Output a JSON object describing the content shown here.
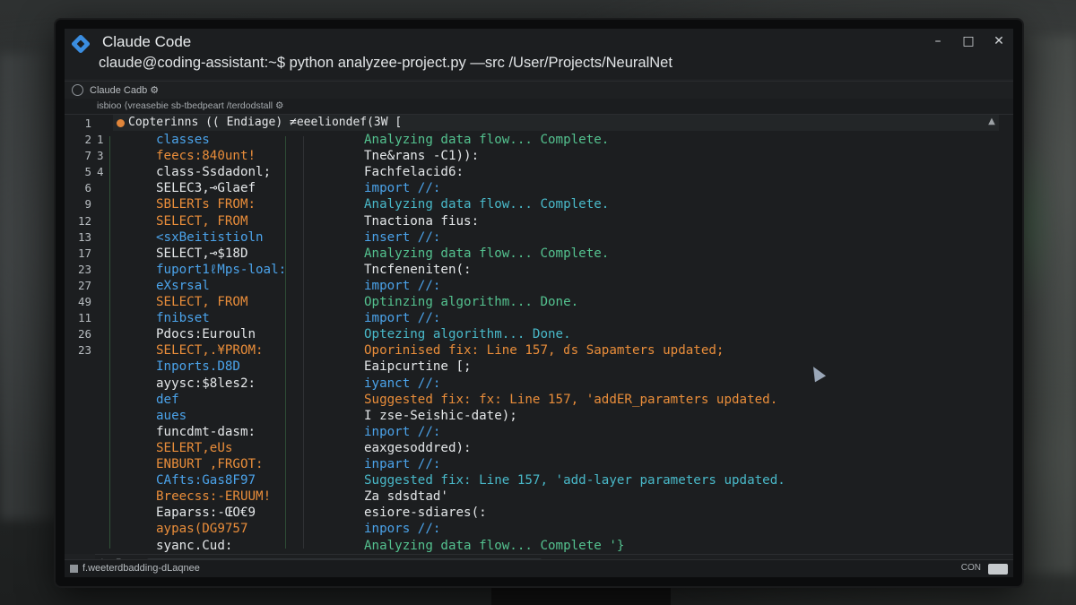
{
  "window": {
    "app_title": "Claude Code",
    "command": "claude@coding-assistant:~$ python analyzee-project.py —src /User/Projects/NeuralNet",
    "controls": [
      "–",
      "□",
      "✕"
    ]
  },
  "tab": {
    "label": "Claude Cadb ⚙"
  },
  "breadcrumb": "isbioo ⟨vreasebie sb-tbedpeart /terdodstall ⚙",
  "editor": {
    "header_text": "Copterinns (( Endiage) ≠eeeliondef(3W [",
    "line_numbers": [
      "2",
      "7",
      "5",
      "6",
      "9",
      "12",
      "13",
      "17",
      "23",
      "27",
      "49",
      "11",
      "26",
      "23"
    ],
    "line_numbers_top": "1",
    "secondary_numbers": [
      "1",
      "3",
      "4"
    ],
    "left_lines": [
      {
        "text": "classes",
        "color": "blue"
      },
      {
        "text": "feecs:840unt!",
        "color": "orange"
      },
      {
        "text": "class-Ssdadonl;",
        "color": "white"
      },
      {
        "text": "SELEC3,⊸Glaef",
        "color": "white"
      },
      {
        "text": "SBLERTs  FROM:",
        "color": "orange"
      },
      {
        "text": "SELECT, FROM",
        "color": "orange"
      },
      {
        "text": "<sxBeitistioln",
        "color": "blue"
      },
      {
        "text": "SELECT,⊸$18D",
        "color": "white"
      },
      {
        "text": "fuport1ℓMps-loal:",
        "color": "blue"
      },
      {
        "text": "eXsrsal",
        "color": "blue"
      },
      {
        "text": "SELECT, FROM",
        "color": "orange"
      },
      {
        "text": "fnibset",
        "color": "blue"
      },
      {
        "text": "Pdocs:Eurouln",
        "color": "white"
      },
      {
        "text": "SELECT,.¥PROM:",
        "color": "orange"
      },
      {
        "text": "Inports.D8D",
        "color": "blue"
      },
      {
        "text": "ayysc:$8les2:",
        "color": "white"
      },
      {
        "text": "def",
        "color": "blue"
      },
      {
        "text": "aues",
        "color": "blue"
      },
      {
        "text": "funcdmt-dasm:",
        "color": "white"
      },
      {
        "text": "SELERT,eUs",
        "color": "orange"
      },
      {
        "text": "ENBURT ,FRGOT:",
        "color": "orange"
      },
      {
        "text": "CAfts:Gas8F97",
        "color": "blue"
      },
      {
        "text": "Breecss:-ERUUM!",
        "color": "orange"
      },
      {
        "text": "Eaparss:-ŒO€9",
        "color": "white"
      },
      {
        "text": "aypas(DG9757",
        "color": "orange"
      },
      {
        "text": "syanc.Cud:",
        "color": "white"
      }
    ],
    "right_lines": [
      {
        "text": "Analyzing data flow... Complete.",
        "color": "green"
      },
      {
        "text": "Tne&rans -C1)):",
        "color": "white"
      },
      {
        "text": "Fachfelacid6:",
        "color": "white"
      },
      {
        "text": "import //:",
        "color": "blue"
      },
      {
        "text": "Analyzing data flow... Complete.",
        "color": "teal"
      },
      {
        "text": "Tnactiona fius:",
        "color": "white"
      },
      {
        "text": "insert //:",
        "color": "blue"
      },
      {
        "text": "Analyzing data flow... Complete.",
        "color": "green"
      },
      {
        "text": "Tncfeneniten(:",
        "color": "white"
      },
      {
        "text": "import //:",
        "color": "blue"
      },
      {
        "text": "Optinzing algorithm... Done.",
        "color": "green"
      },
      {
        "text": "import //:",
        "color": "blue"
      },
      {
        "text": "Optezing algorithm... Done.",
        "color": "teal"
      },
      {
        "text": "Oporinised fix: Line 157, ɗs Sapamters updated;",
        "color": "orange"
      },
      {
        "text": " Eaipcurtine [;",
        "color": "white"
      },
      {
        "text": "iyanct //:",
        "color": "blue"
      },
      {
        "text": "Suggested fix: fx: Line 157, 'addER_paramters updated.",
        "color": "orange"
      },
      {
        "text": "I zse-Seishic-date);",
        "color": "white"
      },
      {
        "text": "inport //:",
        "color": "blue"
      },
      {
        "text": "eaxgesoddred):",
        "color": "white"
      },
      {
        "text": "inpart //:",
        "color": "blue"
      },
      {
        "text": "Suggested fix: Line 157, 'add-layer parameters updated.",
        "color": "teal"
      },
      {
        "text": "Za sdsdtad'",
        "color": "white"
      },
      {
        "text": "esiore-sdiares(:",
        "color": "white"
      },
      {
        "text": "inpors //:",
        "color": "blue"
      },
      {
        "text": "Analyzing data flow... Complete '}",
        "color": "green"
      }
    ]
  },
  "status": {
    "left": "f.weeterdbadding-dLaqnee",
    "right": "CON"
  },
  "colors": {
    "blue": "#4ba3ea",
    "orange": "#e98d3a",
    "white": "#e4e7e9",
    "green": "#54c28f",
    "teal": "#49b9c9",
    "accent_logo": "#3a8de0"
  }
}
